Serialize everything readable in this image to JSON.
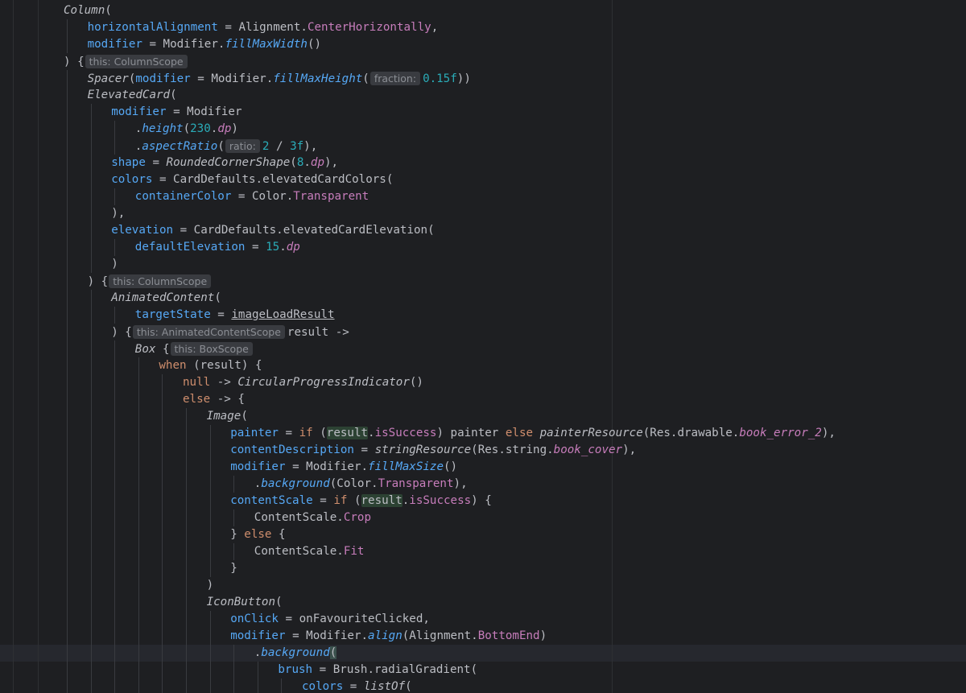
{
  "editor": {
    "lines": [
      {
        "indent": 0,
        "tokens": [
          {
            "t": "Column",
            "k": "fn-call"
          },
          {
            "t": "(",
            "k": "plain"
          }
        ]
      },
      {
        "indent": 1,
        "tokens": [
          {
            "t": "horizontalAlignment",
            "k": "named"
          },
          {
            "t": " = Alignment.",
            "k": "plain"
          },
          {
            "t": "CenterHorizontally",
            "k": "prop"
          },
          {
            "t": ",",
            "k": "plain"
          }
        ]
      },
      {
        "indent": 1,
        "tokens": [
          {
            "t": "modifier",
            "k": "named"
          },
          {
            "t": " = Modifier.",
            "k": "plain"
          },
          {
            "t": "fillMaxWidth",
            "k": "ext-fn"
          },
          {
            "t": "()",
            "k": "plain"
          }
        ]
      },
      {
        "indent": 0,
        "tokens": [
          {
            "t": ") {",
            "k": "plain"
          },
          {
            "t": "this: ColumnScope",
            "k": "hint"
          }
        ]
      },
      {
        "indent": 1,
        "tokens": [
          {
            "t": "Spacer",
            "k": "fn-call"
          },
          {
            "t": "(",
            "k": "plain"
          },
          {
            "t": "modifier",
            "k": "named"
          },
          {
            "t": " = Modifier.",
            "k": "plain"
          },
          {
            "t": "fillMaxHeight",
            "k": "ext-fn"
          },
          {
            "t": "(",
            "k": "plain"
          },
          {
            "t": "fraction:",
            "k": "hint"
          },
          {
            "t": "0.15f",
            "k": "num"
          },
          {
            "t": "))",
            "k": "plain"
          }
        ]
      },
      {
        "indent": 1,
        "tokens": [
          {
            "t": "ElevatedCard",
            "k": "fn-call"
          },
          {
            "t": "(",
            "k": "plain"
          }
        ]
      },
      {
        "indent": 2,
        "tokens": [
          {
            "t": "modifier",
            "k": "named"
          },
          {
            "t": " = Modifier",
            "k": "plain"
          }
        ]
      },
      {
        "indent": 3,
        "tokens": [
          {
            "t": ".",
            "k": "plain"
          },
          {
            "t": "height",
            "k": "ext-fn"
          },
          {
            "t": "(",
            "k": "plain"
          },
          {
            "t": "230",
            "k": "num"
          },
          {
            "t": ".",
            "k": "plain"
          },
          {
            "t": "dp",
            "k": "ext-prop"
          },
          {
            "t": ")",
            "k": "plain"
          }
        ]
      },
      {
        "indent": 3,
        "tokens": [
          {
            "t": ".",
            "k": "plain"
          },
          {
            "t": "aspectRatio",
            "k": "ext-fn"
          },
          {
            "t": "(",
            "k": "plain"
          },
          {
            "t": "ratio:",
            "k": "hint"
          },
          {
            "t": "2",
            "k": "num"
          },
          {
            "t": " / ",
            "k": "plain"
          },
          {
            "t": "3f",
            "k": "num"
          },
          {
            "t": "),",
            "k": "plain"
          }
        ]
      },
      {
        "indent": 2,
        "tokens": [
          {
            "t": "shape",
            "k": "named"
          },
          {
            "t": " = ",
            "k": "plain"
          },
          {
            "t": "RoundedCornerShape",
            "k": "fn-call"
          },
          {
            "t": "(",
            "k": "plain"
          },
          {
            "t": "8",
            "k": "num"
          },
          {
            "t": ".",
            "k": "plain"
          },
          {
            "t": "dp",
            "k": "ext-prop"
          },
          {
            "t": "),",
            "k": "plain"
          }
        ]
      },
      {
        "indent": 2,
        "tokens": [
          {
            "t": "colors",
            "k": "named"
          },
          {
            "t": " = CardDefaults.elevatedCardColors(",
            "k": "plain"
          }
        ]
      },
      {
        "indent": 3,
        "tokens": [
          {
            "t": "containerColor",
            "k": "named"
          },
          {
            "t": " = Color.",
            "k": "plain"
          },
          {
            "t": "Transparent",
            "k": "prop"
          }
        ]
      },
      {
        "indent": 2,
        "tokens": [
          {
            "t": "),",
            "k": "plain"
          }
        ]
      },
      {
        "indent": 2,
        "tokens": [
          {
            "t": "elevation",
            "k": "named"
          },
          {
            "t": " = CardDefaults.elevatedCardElevation(",
            "k": "plain"
          }
        ]
      },
      {
        "indent": 3,
        "tokens": [
          {
            "t": "defaultElevation",
            "k": "named"
          },
          {
            "t": " = ",
            "k": "plain"
          },
          {
            "t": "15",
            "k": "num"
          },
          {
            "t": ".",
            "k": "plain"
          },
          {
            "t": "dp",
            "k": "ext-prop"
          }
        ]
      },
      {
        "indent": 2,
        "tokens": [
          {
            "t": ")",
            "k": "plain"
          }
        ]
      },
      {
        "indent": 1,
        "tokens": [
          {
            "t": ") {",
            "k": "plain"
          },
          {
            "t": "this: ColumnScope",
            "k": "hint"
          }
        ]
      },
      {
        "indent": 2,
        "tokens": [
          {
            "t": "AnimatedContent",
            "k": "fn-call"
          },
          {
            "t": "(",
            "k": "plain"
          }
        ]
      },
      {
        "indent": 3,
        "tokens": [
          {
            "t": "targetState",
            "k": "named"
          },
          {
            "t": " = ",
            "k": "plain"
          },
          {
            "t": "imageLoadResult",
            "k": "under"
          }
        ]
      },
      {
        "indent": 2,
        "tokens": [
          {
            "t": ") {",
            "k": "plain"
          },
          {
            "t": "this: AnimatedContentScope",
            "k": "hint"
          },
          {
            "t": "result ->",
            "k": "plain"
          }
        ]
      },
      {
        "indent": 3,
        "tokens": [
          {
            "t": "Box",
            "k": "fn-call"
          },
          {
            "t": " {",
            "k": "plain"
          },
          {
            "t": "this: BoxScope",
            "k": "hint"
          }
        ]
      },
      {
        "indent": 4,
        "tokens": [
          {
            "t": "when",
            "k": "kw"
          },
          {
            "t": " (result) {",
            "k": "plain"
          }
        ]
      },
      {
        "indent": 5,
        "tokens": [
          {
            "t": "null",
            "k": "kw"
          },
          {
            "t": " -> ",
            "k": "plain"
          },
          {
            "t": "CircularProgressIndicator",
            "k": "fn-call"
          },
          {
            "t": "()",
            "k": "plain"
          }
        ]
      },
      {
        "indent": 5,
        "tokens": [
          {
            "t": "else",
            "k": "kw"
          },
          {
            "t": " -> {",
            "k": "plain"
          }
        ]
      },
      {
        "indent": 6,
        "tokens": [
          {
            "t": "Image",
            "k": "fn-call"
          },
          {
            "t": "(",
            "k": "plain"
          }
        ]
      },
      {
        "indent": 7,
        "tokens": [
          {
            "t": "painter",
            "k": "named"
          },
          {
            "t": " = ",
            "k": "plain"
          },
          {
            "t": "if",
            "k": "kw"
          },
          {
            "t": " (",
            "k": "plain"
          },
          {
            "t": "result",
            "k": "hl"
          },
          {
            "t": ".",
            "k": "plain"
          },
          {
            "t": "isSuccess",
            "k": "prop"
          },
          {
            "t": ") painter ",
            "k": "plain"
          },
          {
            "t": "else",
            "k": "kw"
          },
          {
            "t": " ",
            "k": "plain"
          },
          {
            "t": "painterResource",
            "k": "fn-call"
          },
          {
            "t": "(Res.drawable.",
            "k": "plain"
          },
          {
            "t": "book_error_2",
            "k": "ext-prop"
          },
          {
            "t": "),",
            "k": "plain"
          }
        ]
      },
      {
        "indent": 7,
        "tokens": [
          {
            "t": "contentDescription",
            "k": "named"
          },
          {
            "t": " = ",
            "k": "plain"
          },
          {
            "t": "stringResource",
            "k": "fn-call"
          },
          {
            "t": "(Res.string.",
            "k": "plain"
          },
          {
            "t": "book_cover",
            "k": "ext-prop"
          },
          {
            "t": "),",
            "k": "plain"
          }
        ]
      },
      {
        "indent": 7,
        "tokens": [
          {
            "t": "modifier",
            "k": "named"
          },
          {
            "t": " = Modifier.",
            "k": "plain"
          },
          {
            "t": "fillMaxSize",
            "k": "ext-fn"
          },
          {
            "t": "()",
            "k": "plain"
          }
        ]
      },
      {
        "indent": 8,
        "tokens": [
          {
            "t": ".",
            "k": "plain"
          },
          {
            "t": "background",
            "k": "ext-fn"
          },
          {
            "t": "(Color.",
            "k": "plain"
          },
          {
            "t": "Transparent",
            "k": "prop"
          },
          {
            "t": "),",
            "k": "plain"
          }
        ]
      },
      {
        "indent": 7,
        "tokens": [
          {
            "t": "contentScale",
            "k": "named"
          },
          {
            "t": " = ",
            "k": "plain"
          },
          {
            "t": "if",
            "k": "kw"
          },
          {
            "t": " (",
            "k": "plain"
          },
          {
            "t": "result",
            "k": "hl"
          },
          {
            "t": ".",
            "k": "plain"
          },
          {
            "t": "isSuccess",
            "k": "prop"
          },
          {
            "t": ") {",
            "k": "plain"
          }
        ]
      },
      {
        "indent": 8,
        "tokens": [
          {
            "t": "ContentScale.",
            "k": "plain"
          },
          {
            "t": "Crop",
            "k": "prop"
          }
        ]
      },
      {
        "indent": 7,
        "tokens": [
          {
            "t": "} ",
            "k": "plain"
          },
          {
            "t": "else",
            "k": "kw"
          },
          {
            "t": " {",
            "k": "plain"
          }
        ]
      },
      {
        "indent": 8,
        "tokens": [
          {
            "t": "ContentScale.",
            "k": "plain"
          },
          {
            "t": "Fit",
            "k": "prop"
          }
        ]
      },
      {
        "indent": 7,
        "tokens": [
          {
            "t": "}",
            "k": "plain"
          }
        ]
      },
      {
        "indent": 6,
        "tokens": [
          {
            "t": ")",
            "k": "plain"
          }
        ]
      },
      {
        "indent": 6,
        "tokens": [
          {
            "t": "IconButton",
            "k": "fn-call"
          },
          {
            "t": "(",
            "k": "plain"
          }
        ]
      },
      {
        "indent": 7,
        "tokens": [
          {
            "t": "onClick",
            "k": "named"
          },
          {
            "t": " = onFavouriteClicked,",
            "k": "plain"
          }
        ]
      },
      {
        "indent": 7,
        "tokens": [
          {
            "t": "modifier",
            "k": "named"
          },
          {
            "t": " = Modifier.",
            "k": "plain"
          },
          {
            "t": "align",
            "k": "ext-fn"
          },
          {
            "t": "(Alignment.",
            "k": "plain"
          },
          {
            "t": "BottomEnd",
            "k": "prop"
          },
          {
            "t": ")",
            "k": "plain"
          }
        ]
      },
      {
        "indent": 8,
        "current": true,
        "tokens": [
          {
            "t": ".",
            "k": "plain"
          },
          {
            "t": "background",
            "k": "ext-fn"
          },
          {
            "t": "(",
            "k": "brace-match"
          }
        ]
      },
      {
        "indent": 9,
        "tokens": [
          {
            "t": "brush",
            "k": "named"
          },
          {
            "t": " = Brush.radialGradient(",
            "k": "plain"
          }
        ]
      },
      {
        "indent": 10,
        "tokens": [
          {
            "t": "colors",
            "k": "named"
          },
          {
            "t": " = ",
            "k": "plain"
          },
          {
            "t": "listOf",
            "k": "fn-call"
          },
          {
            "t": "(",
            "k": "plain"
          }
        ]
      }
    ]
  },
  "colors": {
    "background": "#1e1f22",
    "current_line": "#26282e",
    "indent_guide": "#393b40",
    "keyword": "#cf8e6d",
    "named_argument": "#56a8f5",
    "number": "#2aacb8",
    "property": "#c77dbb",
    "plain": "#bcbec4",
    "inlay_hint_bg": "#393b40",
    "inlay_hint_fg": "#8b8e94"
  }
}
